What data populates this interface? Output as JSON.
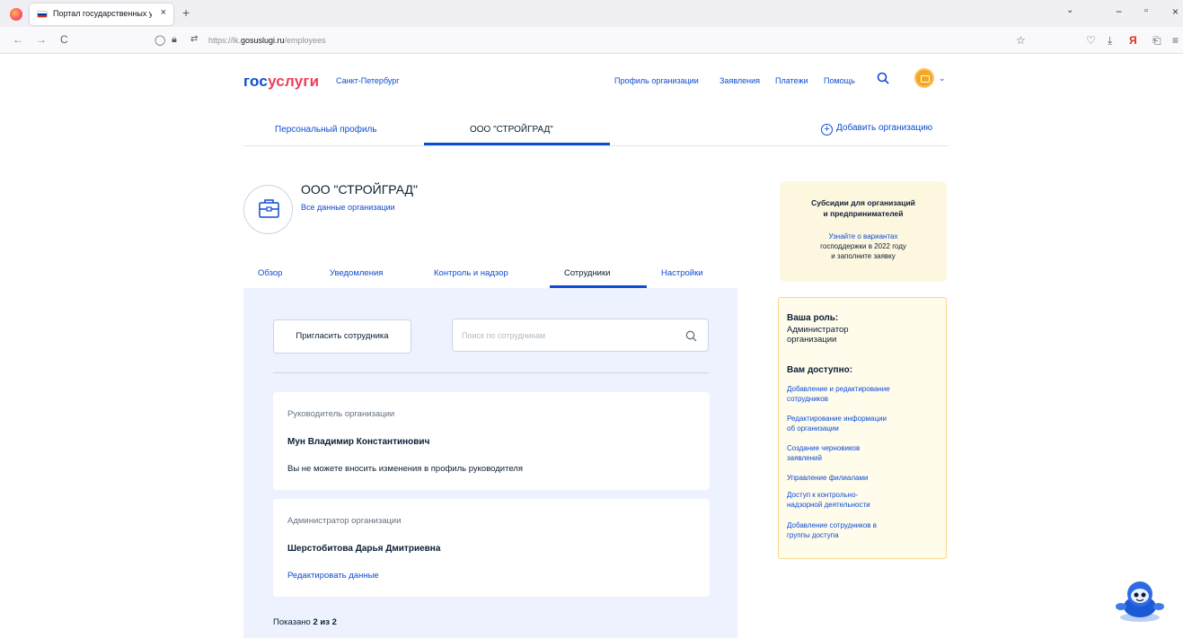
{
  "browser": {
    "tab_title": "Портал государственных услуг",
    "tab_close": "×",
    "new_tab": "+",
    "url_prefix": "https://lk.",
    "url_domain": "gosuslugi.ru",
    "url_path": "/employees",
    "back": "←",
    "forward": "→",
    "reload": "C"
  },
  "header": {
    "logo_part1": "гос",
    "logo_part2": "услуги",
    "city": "Санкт-Петербург",
    "nav": [
      "Профиль организации",
      "Заявления",
      "Платежи",
      "Помощь"
    ]
  },
  "profile_tabs": {
    "personal": "Персональный профиль",
    "org": "ООО \"СТРОЙГРАД\"",
    "add_org": "Добавить организацию",
    "plus": "+"
  },
  "org": {
    "name": "ООО \"СТРОЙГРАД\"",
    "all_data_link": "Все данные организации"
  },
  "section_tabs": [
    "Обзор",
    "Уведомления",
    "Контроль и надзор",
    "Сотрудники",
    "Настройки"
  ],
  "employees": {
    "invite_button": "Пригласить сотрудника",
    "search_placeholder": "Поиск по сотрудникам",
    "cards": [
      {
        "role": "Руководитель организации",
        "name": "Мун Владимир Константинович",
        "note": "Вы не можете вносить изменения в профиль руководителя"
      },
      {
        "role": "Администратор организации",
        "name": "Шерстобитова Дарья Дмитриевна",
        "edit_link": "Редактировать данные"
      }
    ],
    "shown_label": "Показано",
    "shown_count": "2 из 2"
  },
  "promo": {
    "title_line1": "Субсидии для организаций",
    "title_line2": "и предпринимателей",
    "link_text": "Узнайте о вариантах",
    "text_line1": "господдержки в 2022 году",
    "text_line2": "и заполните заявку"
  },
  "role_box": {
    "role_heading": "Ваша роль:",
    "role_line1": "Администратор",
    "role_line2": "организации",
    "available_heading": "Вам доступно:",
    "permissions": [
      [
        "Добавление и редактирование",
        "сотрудников"
      ],
      [
        "Редактирование информации",
        "об организации"
      ],
      [
        "Создание черновиков",
        "заявлений"
      ],
      [
        "Управление филиалами"
      ],
      [
        "Доступ к контрольно-",
        "надзорной деятельности"
      ],
      [
        "Добавление сотрудников в",
        "группы доступа"
      ]
    ]
  },
  "colors": {
    "primary_blue": "#0d4cd3",
    "logo_red": "#ee3f58",
    "panel_bg": "#edf2fe",
    "promo_bg": "#fef7e0",
    "rolebox_bg": "#fffcec"
  }
}
